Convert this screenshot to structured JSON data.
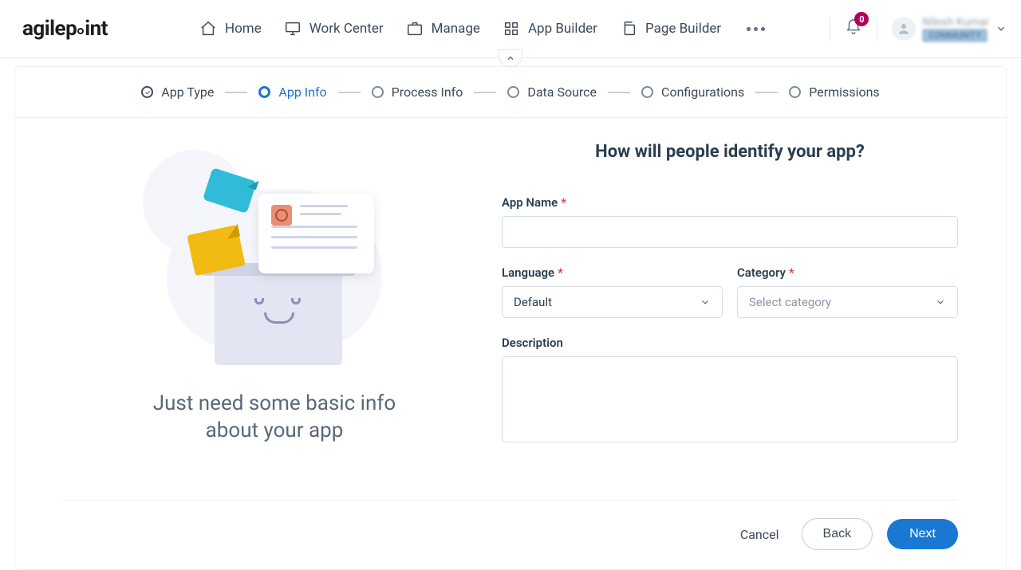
{
  "brand": "agilepoint",
  "nav": {
    "home": "Home",
    "work_center": "Work Center",
    "manage": "Manage",
    "app_builder": "App Builder",
    "page_builder": "Page Builder"
  },
  "notifications": {
    "count": "0"
  },
  "user": {
    "name": "Nilesh Kumar",
    "badge": "COMMUNITY"
  },
  "steps": {
    "app_type": "App Type",
    "app_info": "App Info",
    "process_info": "Process Info",
    "data_source": "Data Source",
    "configurations": "Configurations",
    "permissions": "Permissions"
  },
  "left_heading": "Just need some basic info about your app",
  "form": {
    "title": "How will people identify your app?",
    "app_name_label": "App Name",
    "app_name_value": "",
    "language_label": "Language",
    "language_value": "Default",
    "category_label": "Category",
    "category_placeholder": "Select category",
    "description_label": "Description",
    "description_value": ""
  },
  "buttons": {
    "cancel": "Cancel",
    "back": "Back",
    "next": "Next"
  }
}
